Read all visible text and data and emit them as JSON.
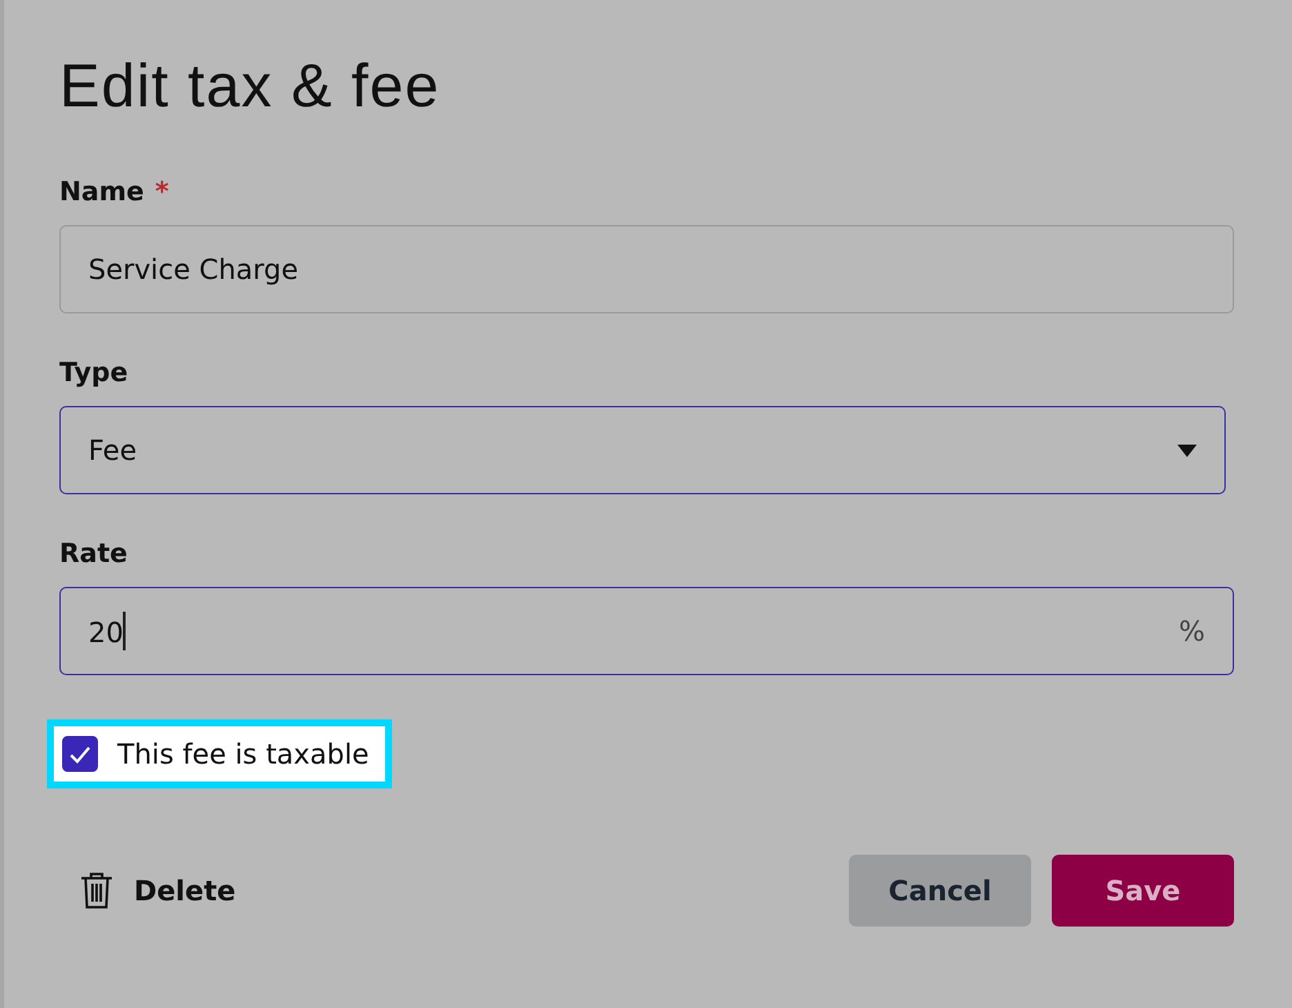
{
  "dialog": {
    "title": "Edit tax & fee"
  },
  "fields": [
    {
      "kind": "text",
      "label": "Name",
      "required_mark": "*",
      "value": "Service Charge",
      "focused": false
    },
    {
      "kind": "select",
      "label": "Type",
      "value": "Fee",
      "focused": true
    },
    {
      "kind": "text",
      "label": "Rate",
      "value": "20",
      "suffix": "%",
      "focused": true
    }
  ],
  "checkbox": {
    "label": "This fee is taxable",
    "checked": true,
    "highlighted": true
  },
  "delete_button": "Delete",
  "buttons": [
    {
      "kind": "secondary",
      "label": "Cancel"
    },
    {
      "kind": "primary",
      "label": "Save"
    }
  ]
}
